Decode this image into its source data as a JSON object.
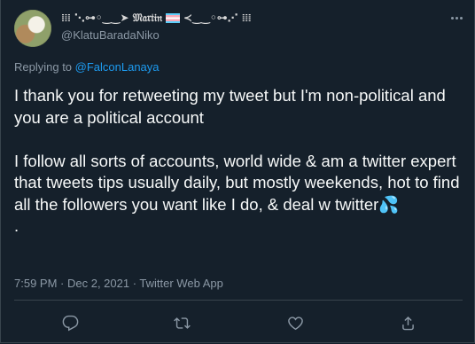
{
  "author": {
    "display_name_prefix": "𝍖 ⋱⊶◦‿‿➤ 𝔐𝔞𝔯𝔱𝔦𝔫",
    "display_name_suffix": "≺‿‿◦⊶⋰ 𝍖",
    "handle": "@KlatuBaradaNiko"
  },
  "reply": {
    "prefix": "Replying to ",
    "mention": "@FalconLanaya"
  },
  "tweet": {
    "paragraph1": "I thank you for retweeting my tweet but I'm non-political and you are a political account",
    "paragraph2": "I follow all sorts of accounts, world wide & am a twitter expert that tweets tips usually daily, but mostly weekends, hot to find all the followers you want like I do,  & deal w twitter💦",
    "paragraph3": "."
  },
  "meta": {
    "time": "7:59 PM",
    "separator1": " · ",
    "date": "Dec 2, 2021",
    "separator2": " · ",
    "source": "Twitter Web App"
  },
  "icons": {
    "more": "more-icon",
    "reply": "reply-icon",
    "retweet": "retweet-icon",
    "like": "like-icon",
    "share": "share-icon"
  },
  "colors": {
    "background": "#15202b",
    "accent": "#1d9bf0",
    "secondary_text": "#8b98a5",
    "primary_text": "#f7f9f9"
  }
}
